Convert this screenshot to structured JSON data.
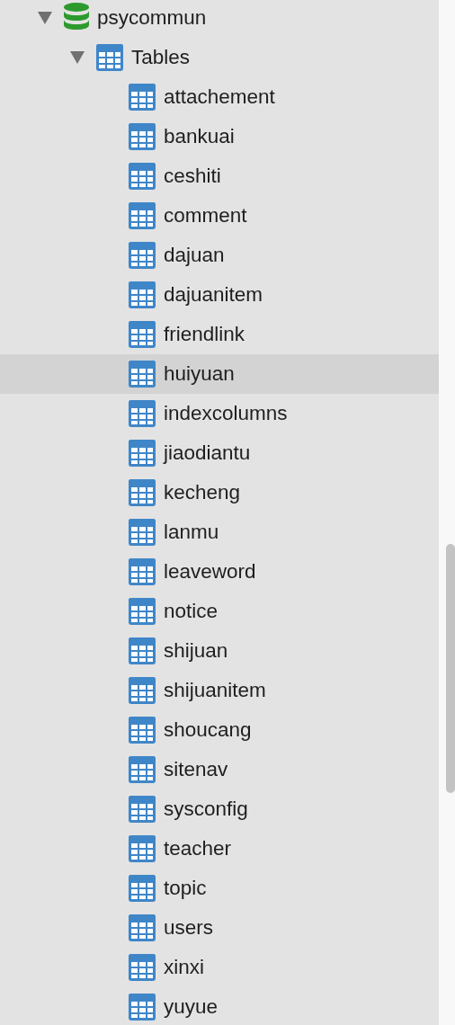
{
  "sidebar": {
    "tree": [
      {
        "kind": "database",
        "label": "psycommun",
        "expanded": true,
        "selected": false,
        "children": [
          {
            "kind": "group",
            "label": "Tables",
            "expanded": true,
            "selected": false,
            "children": [
              {
                "kind": "table",
                "label": "attachement",
                "selected": false
              },
              {
                "kind": "table",
                "label": "bankuai",
                "selected": false
              },
              {
                "kind": "table",
                "label": "ceshiti",
                "selected": false
              },
              {
                "kind": "table",
                "label": "comment",
                "selected": false
              },
              {
                "kind": "table",
                "label": "dajuan",
                "selected": false
              },
              {
                "kind": "table",
                "label": "dajuanitem",
                "selected": false
              },
              {
                "kind": "table",
                "label": "friendlink",
                "selected": false
              },
              {
                "kind": "table",
                "label": "huiyuan",
                "selected": true
              },
              {
                "kind": "table",
                "label": "indexcolumns",
                "selected": false
              },
              {
                "kind": "table",
                "label": "jiaodiantu",
                "selected": false
              },
              {
                "kind": "table",
                "label": "kecheng",
                "selected": false
              },
              {
                "kind": "table",
                "label": "lanmu",
                "selected": false
              },
              {
                "kind": "table",
                "label": "leaveword",
                "selected": false
              },
              {
                "kind": "table",
                "label": "notice",
                "selected": false
              },
              {
                "kind": "table",
                "label": "shijuan",
                "selected": false
              },
              {
                "kind": "table",
                "label": "shijuanitem",
                "selected": false
              },
              {
                "kind": "table",
                "label": "shoucang",
                "selected": false
              },
              {
                "kind": "table",
                "label": "sitenav",
                "selected": false
              },
              {
                "kind": "table",
                "label": "sysconfig",
                "selected": false
              },
              {
                "kind": "table",
                "label": "teacher",
                "selected": false
              },
              {
                "kind": "table",
                "label": "topic",
                "selected": false
              },
              {
                "kind": "table",
                "label": "users",
                "selected": false
              },
              {
                "kind": "table",
                "label": "xinxi",
                "selected": false
              },
              {
                "kind": "table",
                "label": "yuyue",
                "selected": false
              }
            ]
          }
        ]
      }
    ]
  }
}
